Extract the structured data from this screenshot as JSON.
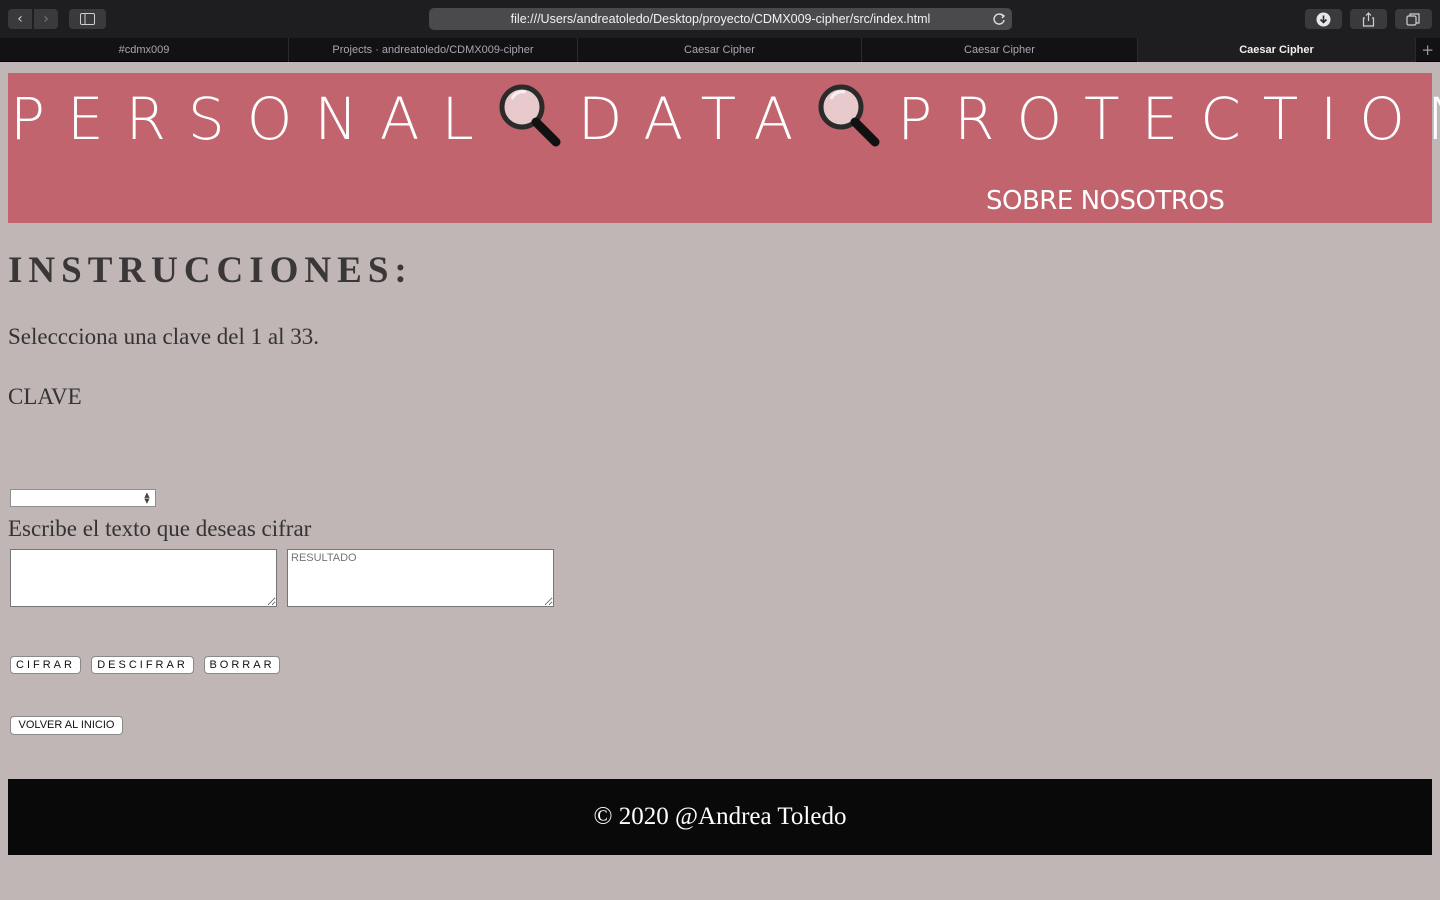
{
  "browser": {
    "url": "file:///Users/andreatoledo/Desktop/proyecto/CDMX009-cipher/src/index.html",
    "tabs": [
      {
        "label": "#cdmx009"
      },
      {
        "label": "Projects · andreatoledo/CDMX009-cipher"
      },
      {
        "label": "Caesar Cipher"
      },
      {
        "label": "Caesar Cipher"
      },
      {
        "label": "Caesar Cipher",
        "active": true
      }
    ],
    "icons": [
      "back-icon",
      "forward-icon",
      "sidebar-icon",
      "reload-icon",
      "download-icon",
      "share-icon",
      "tabs-overview-icon",
      "new-tab-icon"
    ]
  },
  "header": {
    "banner_words": [
      "PERSONAL",
      "DATA",
      "PROTECTION"
    ],
    "banner_icon": "magnifying-glass-icon",
    "about_link": "SOBRE NOSOTROS",
    "color": "#c1646d"
  },
  "main": {
    "title": "INSTRUCCIONES:",
    "instruction": "Seleccciona una clave del 1 al 33.",
    "key_label": "CLAVE",
    "key_value": "",
    "write_label": "Escribe el texto que deseas cifrar",
    "input_text": "",
    "result_placeholder": "RESULTADO",
    "buttons": {
      "encrypt": "CIFRAR",
      "decrypt": "DESCIFRAR",
      "clear": "BORRAR",
      "home": "VOLVER AL INICIO"
    }
  },
  "footer": {
    "text": "© 2020 @Andrea Toledo"
  },
  "colors": {
    "page_bg": "#bfb6b5",
    "header_bg": "#c1646d",
    "footer_bg": "#09090a"
  }
}
